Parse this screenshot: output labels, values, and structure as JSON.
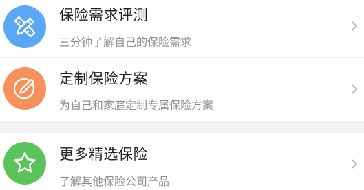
{
  "items": [
    {
      "title": "保险需求评测",
      "subtitle": "三分钟了解自己的保险需求",
      "icon": "pencil-ruler-icon",
      "color": "#5aa7f5"
    },
    {
      "title": "定制保险方案",
      "subtitle": "为自己和家庭定制专属保险方案",
      "icon": "edit-circle-icon",
      "color": "#f7915b"
    },
    {
      "title": "更多精选保险",
      "subtitle": "了解其他保险公司产品",
      "icon": "star-icon",
      "color": "#5bc35b"
    }
  ],
  "chevron_color": "#a8a8a8"
}
